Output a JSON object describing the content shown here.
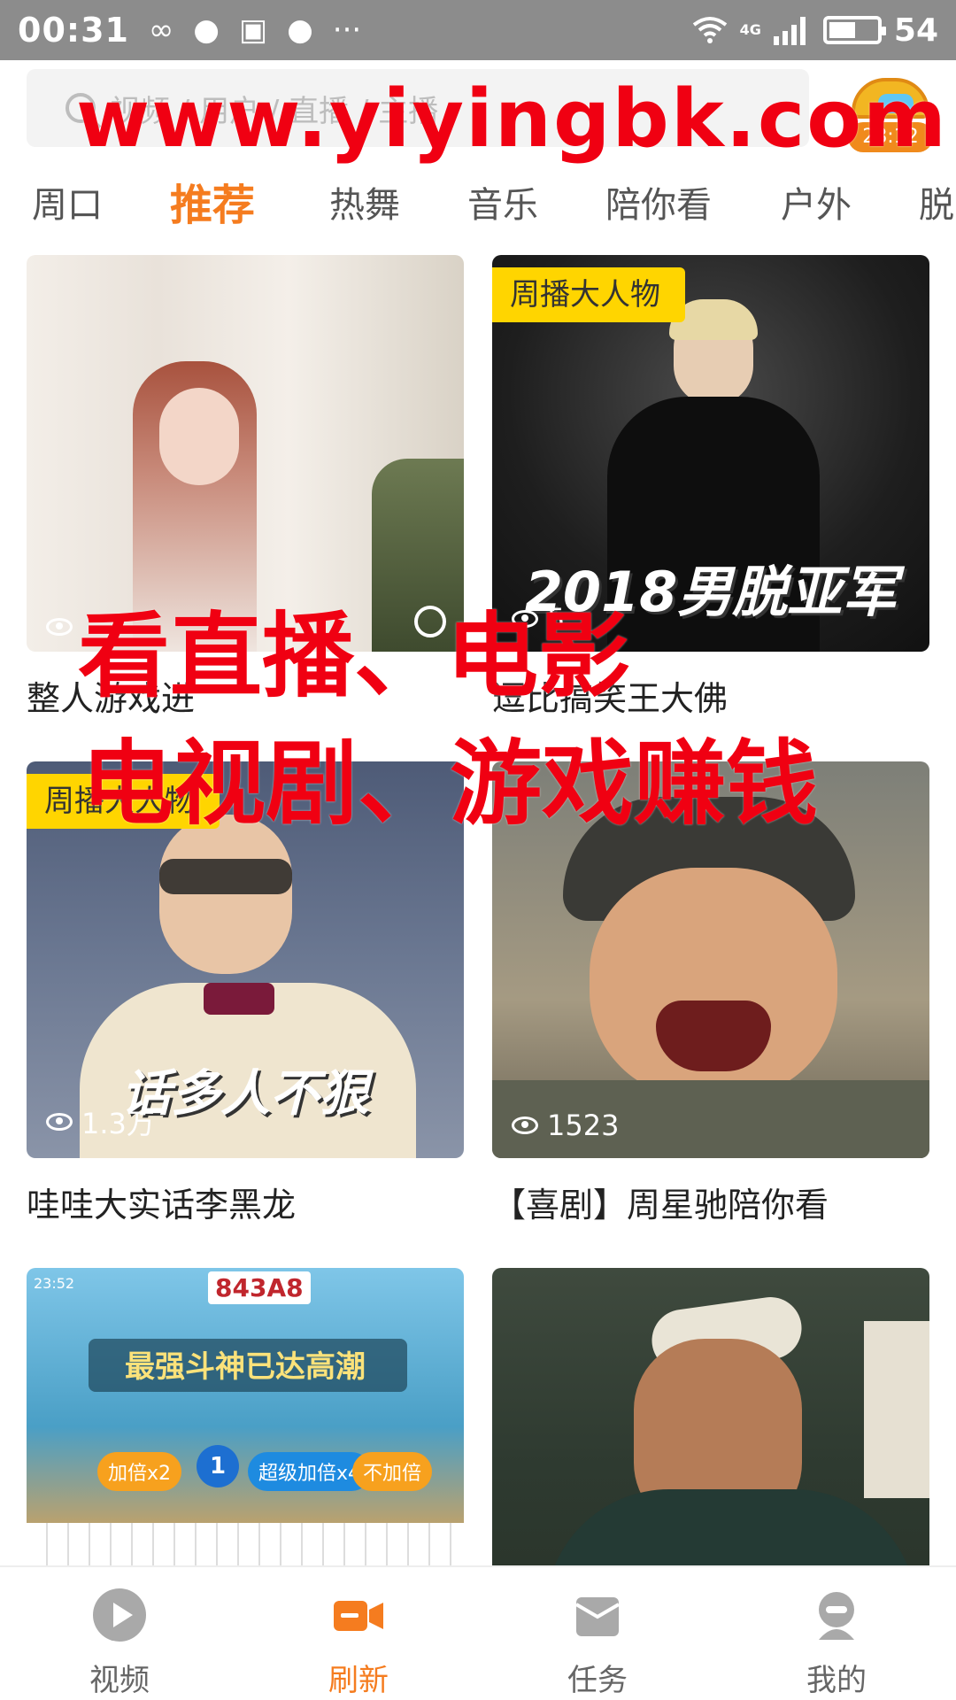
{
  "status_bar": {
    "time": "00:31",
    "network": "4G",
    "battery": "54",
    "battery_level": 0.54,
    "icons": [
      "infinity-icon",
      "chat-bubble-icon",
      "mail-check-icon",
      "message-icon",
      "more-dots-icon",
      "wifi-icon",
      "signal-icon",
      "battery-icon"
    ]
  },
  "search": {
    "placeholder": "视频 / 用户 / 直播 / 主播"
  },
  "treasure": {
    "timer": "28:12",
    "icon": "treasure-chest-icon"
  },
  "watermark": {
    "url": "www.yiyingbk.com",
    "line1": "看直播、电影",
    "line2": "电视剧、游戏赚钱",
    "color": "#f00012"
  },
  "tabs": [
    "周口",
    "推荐",
    "热舞",
    "音乐",
    "陪你看",
    "户外",
    "脱"
  ],
  "active_tab": "推荐",
  "feed": [
    {
      "caption": "整人游戏进",
      "views": "",
      "badge": "",
      "overlay": ""
    },
    {
      "caption": "逗比搞笑王大佛",
      "views": "5",
      "badge": "周播大人物",
      "overlay": "2018男脱亚军"
    },
    {
      "caption": "哇哇大实话李黑龙",
      "views": "1.3万",
      "badge": "周播大人物",
      "overlay": "话多人不狠"
    },
    {
      "caption": "【喜剧】周星驰陪你看",
      "views": "1523",
      "badge": "",
      "overlay": ""
    },
    {
      "caption": "",
      "views": "",
      "badge": "",
      "overlay": "最强斗神已达高潮",
      "game": {
        "clock": "23:52",
        "cards": "843A8",
        "btn1": "加倍x2",
        "btn_mid": "1",
        "btn2": "超级加倍x4",
        "btn3": "不加倍"
      }
    },
    {
      "caption": "",
      "views": "",
      "badge": "",
      "overlay": ""
    }
  ],
  "bottom_nav": [
    {
      "label": "视频",
      "icon": "play-circle-icon"
    },
    {
      "label": "刷新",
      "icon": "video-camera-icon"
    },
    {
      "label": "任务",
      "icon": "task-box-icon"
    },
    {
      "label": "我的",
      "icon": "profile-icon"
    }
  ],
  "active_nav": "刷新",
  "colors": {
    "accent": "#f57c1f",
    "badge": "#ffd500",
    "status_bar": "#8c8c8c"
  }
}
